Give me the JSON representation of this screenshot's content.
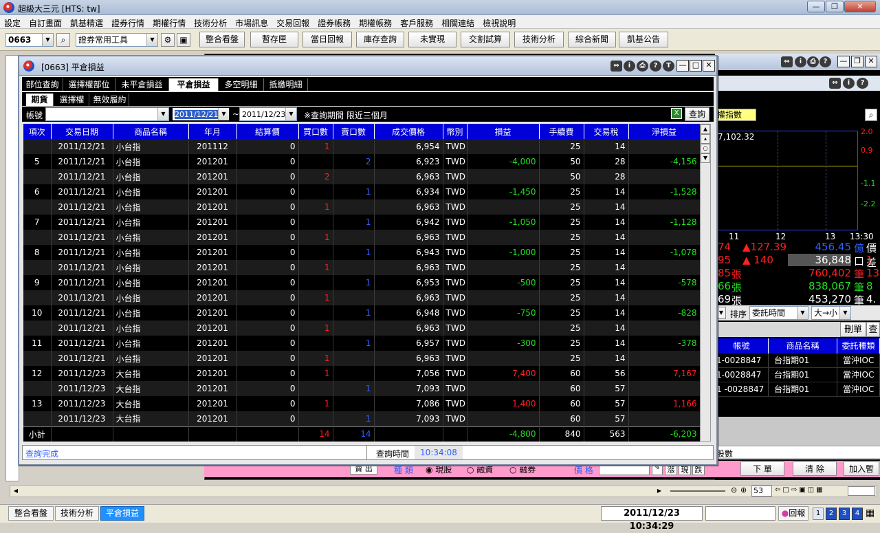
{
  "app": {
    "title": "超級大三元 [HTS: tw]"
  },
  "menu": [
    "設定",
    "自訂畫面",
    "凱基精選",
    "證券行情",
    "期權行情",
    "技術分析",
    "市場訊息",
    "交易回報",
    "證券帳務",
    "期權帳務",
    "客戶服務",
    "相關連結",
    "檢視說明"
  ],
  "toolbar": {
    "code": "0663",
    "tools_combo": "證券常用工具",
    "buttons": [
      "整合看盤",
      "暫存匣",
      "當日回報",
      "庫存查詢",
      "未實現",
      "交割試算",
      "技術分析",
      "綜合新聞",
      "凱基公告"
    ]
  },
  "window": {
    "title": "[0663] 平倉損益",
    "top_tabs": [
      "部位查詢",
      "選擇權部位",
      "未平倉損益",
      "平倉損益",
      "多空明細",
      "抵繳明細"
    ],
    "selected_top_tab": "平倉損益",
    "sub_tabs": [
      "期貨",
      "選擇權",
      "無效履約"
    ],
    "selected_sub_tab": "期貨"
  },
  "filter": {
    "account_label": "帳號",
    "date_from": "2011/12/21",
    "date_sep": "~",
    "date_to": "2011/12/23",
    "note": "※查詢期間 限近三個月",
    "query_button": "查詢"
  },
  "table": {
    "columns": [
      "項次",
      "交易日期",
      "商品名稱",
      "年月",
      "結算價",
      "買口數",
      "賣口數",
      "成交價格",
      "幣別",
      "損益",
      "手續費",
      "交易稅",
      "淨損益"
    ],
    "rows": [
      [
        "",
        "2011/12/21",
        "小台指",
        "201112",
        "0",
        "1",
        "",
        "6,954",
        "TWD",
        "",
        "25",
        "14",
        ""
      ],
      [
        "5",
        "2011/12/21",
        "小台指",
        "201201",
        "0",
        "",
        "2",
        "6,923",
        "TWD",
        "-4,000",
        "50",
        "28",
        "-4,156"
      ],
      [
        "",
        "2011/12/21",
        "小台指",
        "201201",
        "0",
        "2",
        "",
        "6,963",
        "TWD",
        "",
        "50",
        "28",
        ""
      ],
      [
        "6",
        "2011/12/21",
        "小台指",
        "201201",
        "0",
        "",
        "1",
        "6,934",
        "TWD",
        "-1,450",
        "25",
        "14",
        "-1,528"
      ],
      [
        "",
        "2011/12/21",
        "小台指",
        "201201",
        "0",
        "1",
        "",
        "6,963",
        "TWD",
        "",
        "25",
        "14",
        ""
      ],
      [
        "7",
        "2011/12/21",
        "小台指",
        "201201",
        "0",
        "",
        "1",
        "6,942",
        "TWD",
        "-1,050",
        "25",
        "14",
        "-1,128"
      ],
      [
        "",
        "2011/12/21",
        "小台指",
        "201201",
        "0",
        "1",
        "",
        "6,963",
        "TWD",
        "",
        "25",
        "14",
        ""
      ],
      [
        "8",
        "2011/12/21",
        "小台指",
        "201201",
        "0",
        "",
        "1",
        "6,943",
        "TWD",
        "-1,000",
        "25",
        "14",
        "-1,078"
      ],
      [
        "",
        "2011/12/21",
        "小台指",
        "201201",
        "0",
        "1",
        "",
        "6,963",
        "TWD",
        "",
        "25",
        "14",
        ""
      ],
      [
        "9",
        "2011/12/21",
        "小台指",
        "201201",
        "0",
        "",
        "1",
        "6,953",
        "TWD",
        "-500",
        "25",
        "14",
        "-578"
      ],
      [
        "",
        "2011/12/21",
        "小台指",
        "201201",
        "0",
        "1",
        "",
        "6,963",
        "TWD",
        "",
        "25",
        "14",
        ""
      ],
      [
        "10",
        "2011/12/21",
        "小台指",
        "201201",
        "0",
        "",
        "1",
        "6,948",
        "TWD",
        "-750",
        "25",
        "14",
        "-828"
      ],
      [
        "",
        "2011/12/21",
        "小台指",
        "201201",
        "0",
        "1",
        "",
        "6,963",
        "TWD",
        "",
        "25",
        "14",
        ""
      ],
      [
        "11",
        "2011/12/21",
        "小台指",
        "201201",
        "0",
        "",
        "1",
        "6,957",
        "TWD",
        "-300",
        "25",
        "14",
        "-378"
      ],
      [
        "",
        "2011/12/21",
        "小台指",
        "201201",
        "0",
        "1",
        "",
        "6,963",
        "TWD",
        "",
        "25",
        "14",
        ""
      ],
      [
        "12",
        "2011/12/23",
        "大台指",
        "201201",
        "0",
        "1",
        "",
        "7,056",
        "TWD",
        "7,400",
        "60",
        "56",
        "7,167"
      ],
      [
        "",
        "2011/12/23",
        "大台指",
        "201201",
        "0",
        "",
        "1",
        "7,093",
        "TWD",
        "",
        "60",
        "57",
        ""
      ],
      [
        "13",
        "2011/12/23",
        "大台指",
        "201201",
        "0",
        "1",
        "",
        "7,086",
        "TWD",
        "1,400",
        "60",
        "57",
        "1,166"
      ],
      [
        "",
        "2011/12/23",
        "大台指",
        "201201",
        "0",
        "",
        "1",
        "7,093",
        "TWD",
        "",
        "60",
        "57",
        ""
      ]
    ],
    "subtotal": [
      "小計",
      "",
      "",
      "",
      "",
      "14",
      "14",
      "",
      "",
      "-4,800",
      "840",
      "563",
      "-6,203"
    ]
  },
  "status": {
    "message": "查詢完成",
    "time_label": "查詢時間",
    "time": "10:34:08"
  },
  "right_panel": {
    "title": "權指數",
    "value": "7,102.32",
    "y_ticks": [
      "2.0",
      "0.9",
      "-1.1",
      "-2.2"
    ],
    "x_ticks": [
      "11",
      "12",
      "13",
      "13:30"
    ],
    "quotes": [
      [
        "74",
        "▲127.39",
        "456.45",
        "億",
        "價差"
      ],
      [
        "95",
        "▲ 140",
        "36,848",
        "口",
        "1"
      ],
      [
        "85",
        "張",
        "760,402",
        "筆",
        "13"
      ],
      [
        "66",
        "張",
        "838,067",
        "筆",
        "8"
      ],
      [
        "69",
        "張",
        "453,270",
        "筆",
        "4."
      ]
    ],
    "sort_label": "排序",
    "sort_value": "委託時間",
    "order_value": "大→小",
    "delete_btn": "刪單",
    "query_btn": "查",
    "order_columns": [
      "帳號",
      "商品名稱",
      "委託種類"
    ],
    "orders": [
      [
        "1-0028847",
        "台指期01",
        "當沖IOC"
      ],
      [
        "1-0028847",
        "台指期01",
        "當沖IOC"
      ],
      [
        "1 -0028847",
        "台指期01",
        "當沖IOC"
      ]
    ],
    "qty_label": "股數"
  },
  "order_bar": {
    "type_label": "種  類",
    "opt1": "現股",
    "opt2": "融資",
    "opt3": "融券",
    "price_label": "價  格",
    "btn_place": "下  單",
    "btn_clear": "清  除",
    "btn_add": "加入暫"
  },
  "bottom": {
    "zoom": "53",
    "tabs": [
      "整合看盤",
      "技術分析",
      "平倉損益"
    ],
    "active_tab": "平倉損益",
    "clock": "2011/12/23 10:34:29",
    "reply": "回報"
  }
}
